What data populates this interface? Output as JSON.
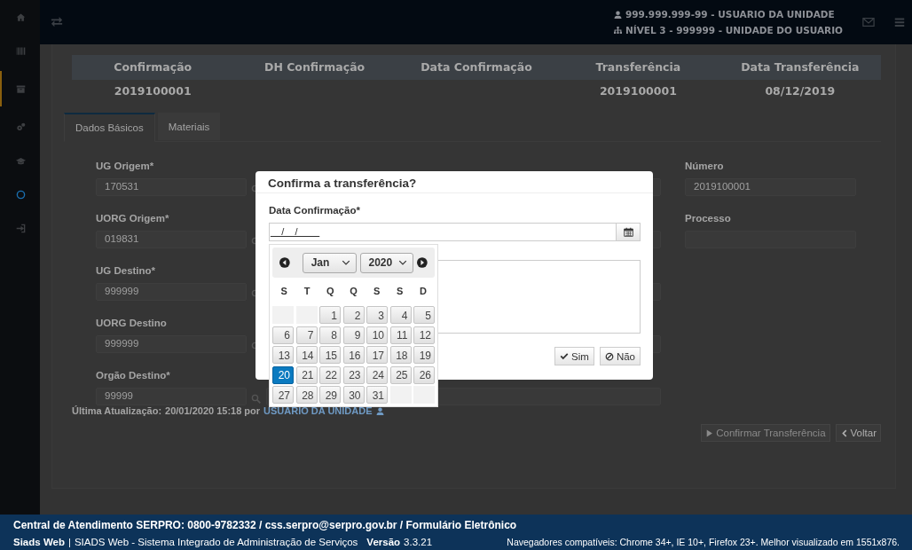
{
  "sidebar": {
    "items": [
      {
        "kind": "home",
        "selected": false
      },
      {
        "kind": "barcode",
        "selected": false
      },
      {
        "kind": "archive",
        "selected": true
      },
      {
        "kind": "cogs",
        "selected": false
      },
      {
        "kind": "cap",
        "selected": false
      },
      {
        "kind": "circle",
        "selected": false
      },
      {
        "kind": "signin",
        "selected": false
      }
    ]
  },
  "topbar": {
    "user": "999.999.999-99 - USUARIO DA UNIDADE",
    "unit": "NÍVEL 3 - 999999 - UNIDADE DO USUARIO"
  },
  "summary": {
    "columns": [
      {
        "header": "Confirmação",
        "value": "2019100001"
      },
      {
        "header": "DH Confirmação"
      },
      {
        "header": "Data Confirmação"
      },
      {
        "header": "Transferência",
        "value": "2019100001"
      },
      {
        "header": "Data Transferência",
        "value": "08/12/2019"
      }
    ]
  },
  "tabs": [
    {
      "label": "Dados Básicos",
      "selected": true
    },
    {
      "label": "Materiais",
      "selected": false
    }
  ],
  "form": {
    "left": [
      {
        "label": "UG Origem*",
        "value": "170531"
      },
      {
        "label": "UORG Origem*",
        "value": "019831"
      },
      {
        "label": "UG Destino*",
        "value": "999999"
      },
      {
        "label": "UORG Destino",
        "value": "999999"
      },
      {
        "label": "Orgão Destino*",
        "value": "99999"
      }
    ],
    "right": [
      {
        "label": "Número",
        "value": "2019100001"
      },
      {
        "label": "Processo"
      }
    ]
  },
  "last_update": {
    "label": "Última Atualização:",
    "text": "20/01/2020 15:18 por",
    "user": "USUARIO DA UNIDADE"
  },
  "actions": [
    {
      "label": "Confirmar Transferência",
      "kind": "play",
      "disabled": true
    },
    {
      "label": "Voltar",
      "kind": "back",
      "disabled": false
    }
  ],
  "dialog": {
    "title": "Confirma a transferência?",
    "field_label": "Data Confirmação*",
    "date_value": "__/__/____",
    "buttons": [
      {
        "label": "Sim",
        "kind": "check"
      },
      {
        "label": "Não",
        "kind": "ban"
      }
    ]
  },
  "datepicker": {
    "month": "Jan",
    "year": "2020",
    "weekdays": [
      "S",
      "T",
      "Q",
      "Q",
      "S",
      "S",
      "D"
    ],
    "weeks": [
      [
        {
          "kind": "empty"
        },
        {
          "kind": "empty"
        },
        {
          "day": "1",
          "selected": false
        },
        {
          "day": "2",
          "selected": false
        },
        {
          "day": "3",
          "selected": false
        },
        {
          "day": "4",
          "selected": false
        },
        {
          "day": "5",
          "selected": false
        }
      ],
      [
        {
          "day": "6",
          "selected": false
        },
        {
          "day": "7",
          "selected": false
        },
        {
          "day": "8",
          "selected": false
        },
        {
          "day": "9",
          "selected": false
        },
        {
          "day": "10",
          "selected": false
        },
        {
          "day": "11",
          "selected": false
        },
        {
          "day": "12",
          "selected": false
        }
      ],
      [
        {
          "day": "13",
          "selected": false
        },
        {
          "day": "14",
          "selected": false
        },
        {
          "day": "15",
          "selected": false
        },
        {
          "day": "16",
          "selected": false
        },
        {
          "day": "17",
          "selected": false
        },
        {
          "day": "18",
          "selected": false
        },
        {
          "day": "19",
          "selected": false
        }
      ],
      [
        {
          "day": "20",
          "selected": true
        },
        {
          "day": "21",
          "selected": false
        },
        {
          "day": "22",
          "selected": false
        },
        {
          "day": "23",
          "selected": false
        },
        {
          "day": "24",
          "selected": false
        },
        {
          "day": "25",
          "selected": false
        },
        {
          "day": "26",
          "selected": false
        }
      ],
      [
        {
          "day": "27",
          "selected": false
        },
        {
          "day": "28",
          "selected": false
        },
        {
          "day": "29",
          "selected": false
        },
        {
          "day": "30",
          "selected": false
        },
        {
          "day": "31",
          "selected": false
        },
        {
          "kind": "empty"
        },
        {
          "kind": "empty"
        }
      ]
    ]
  },
  "footer": {
    "contact": "Central de Atendimento SERPRO: 0800-9782332 / css.serpro@serpro.gov.br / Formulário Eletrônico",
    "app": "Siads Web",
    "separator": "|",
    "description": "SIADS Web - Sistema Integrado de Administração de Serviços",
    "version_label": "Versão",
    "version": "3.3.21",
    "browsers": "Navegadores compatíveis: Chrome 34+, IE 10+, Firefox 23+. Melhor visualizado em 1551x876."
  }
}
